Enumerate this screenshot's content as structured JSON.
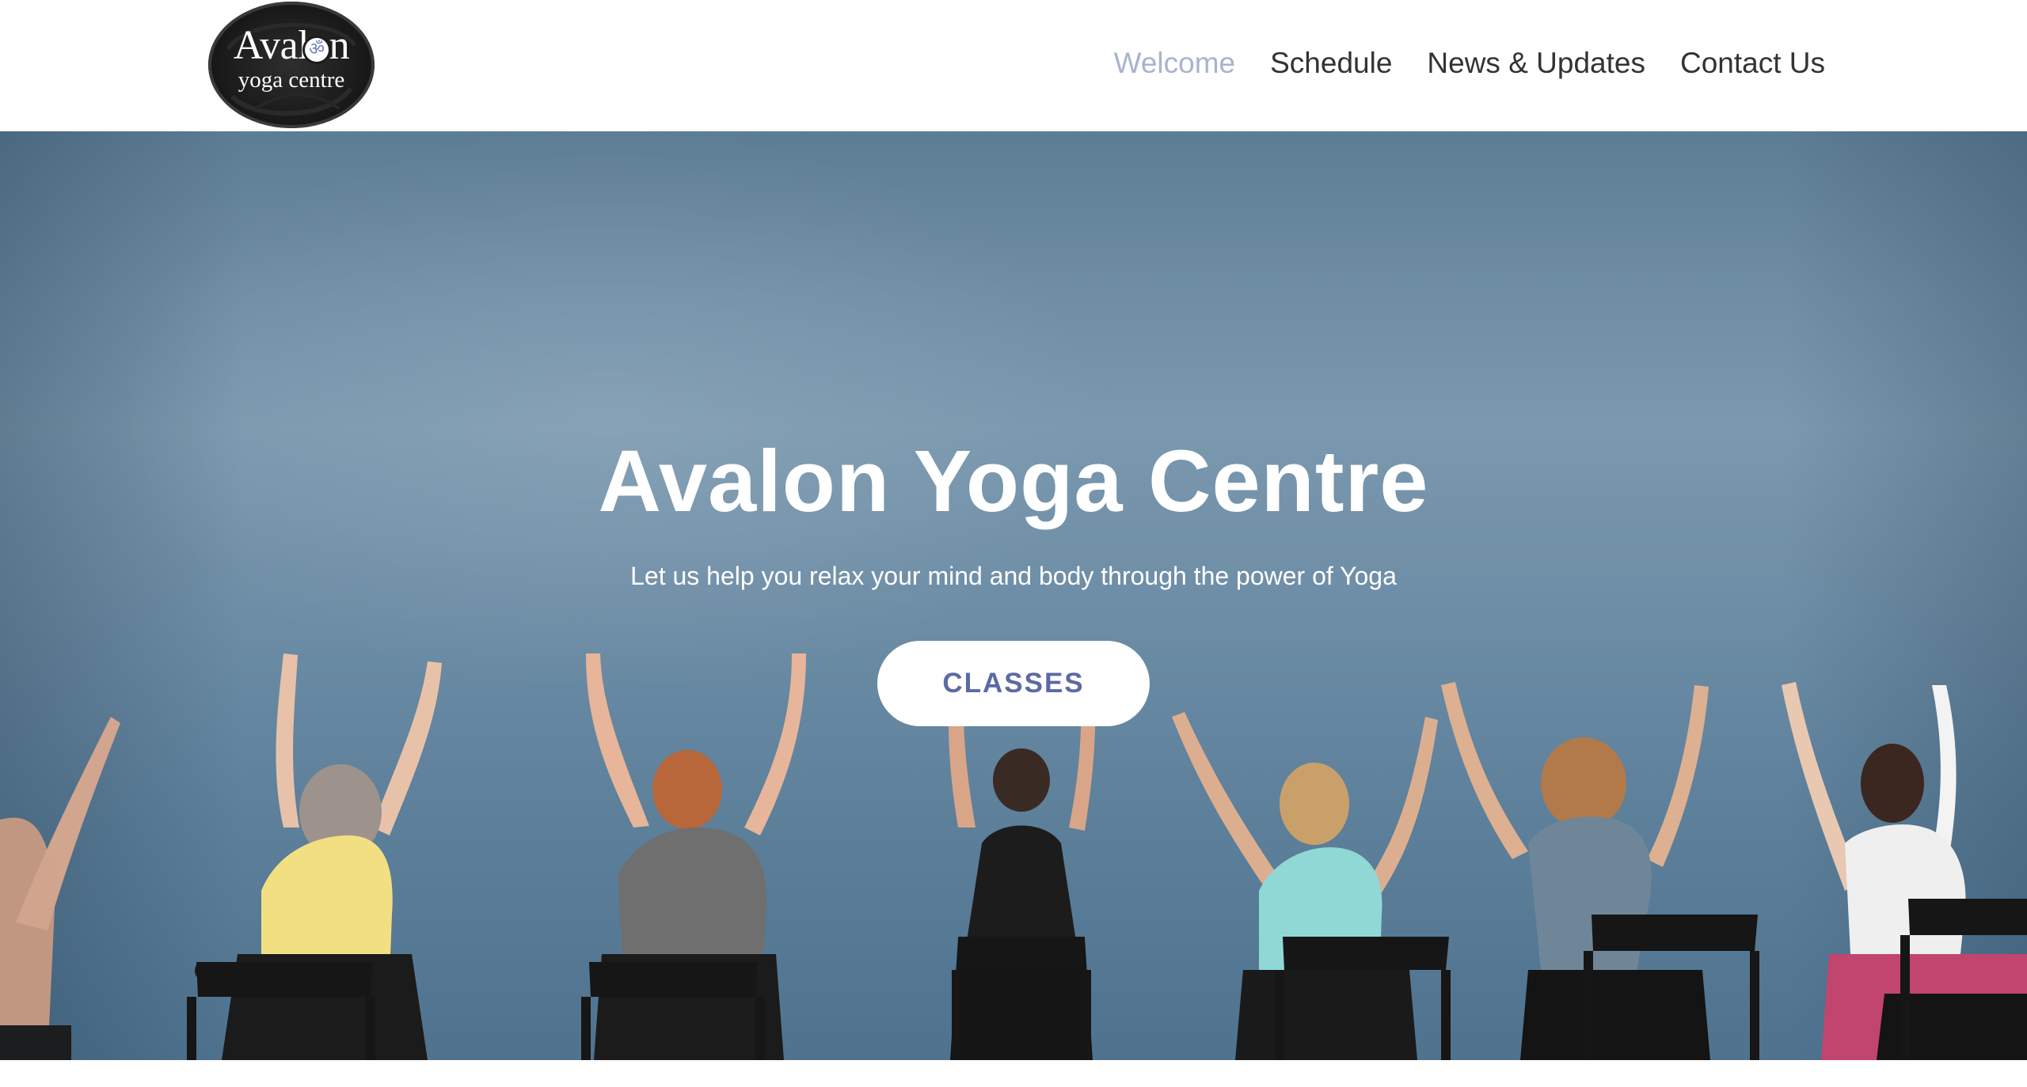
{
  "header": {
    "logo": {
      "name": "Avalon",
      "subtitle": "yoga centre"
    },
    "nav": [
      {
        "label": "Welcome",
        "active": true
      },
      {
        "label": "Schedule",
        "active": false
      },
      {
        "label": "News & Updates",
        "active": false
      },
      {
        "label": "Contact Us",
        "active": false
      }
    ]
  },
  "hero": {
    "title": "Avalon Yoga Centre",
    "subtitle": "Let us help you relax your mind and body through the power of Yoga",
    "button_label": "CLASSES"
  },
  "colors": {
    "nav_active": "#a9b3cf",
    "nav_text": "#333333",
    "button_text": "#5c6aa4",
    "hero_wall": "#6f8ea6"
  }
}
